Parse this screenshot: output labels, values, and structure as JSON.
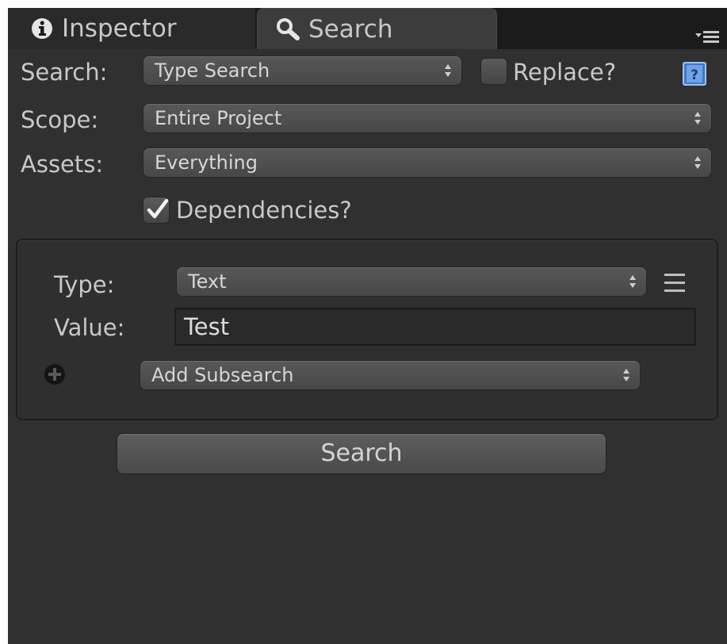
{
  "tabs": {
    "inspector": {
      "label": "Inspector",
      "icon": "info-icon"
    },
    "search": {
      "label": "Search",
      "icon": "magnifier-icon",
      "active": true
    },
    "menu_icon": "panel-menu-icon"
  },
  "form": {
    "search_label": "Search:",
    "search_type": "Type Search",
    "replace_label": "Replace?",
    "replace_checked": false,
    "help_icon": "help-book-icon",
    "scope_label": "Scope:",
    "scope_value": "Entire Project",
    "assets_label": "Assets:",
    "assets_value": "Everything",
    "dependencies_label": "Dependencies?",
    "dependencies_checked": true
  },
  "subsearch": {
    "type_label": "Type:",
    "type_value": "Text",
    "value_label": "Value:",
    "value_text": "Test",
    "add_subsearch": "Add Subsearch"
  },
  "actions": {
    "search_button": "Search"
  },
  "colors": {
    "panel_background": "#303030",
    "tabbar_background": "#1b1b1b",
    "text": "#c8c8c8"
  }
}
